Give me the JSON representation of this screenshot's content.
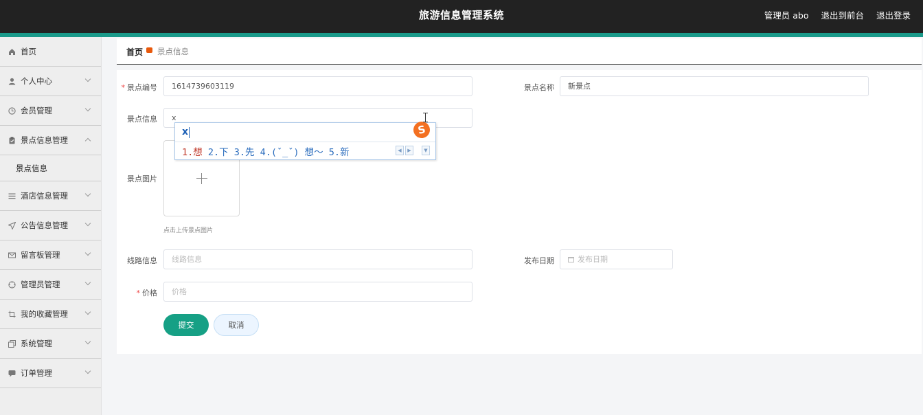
{
  "header": {
    "title": "旅游信息管理系统",
    "user": "管理员 abo",
    "to_front": "退出到前台",
    "logout": "退出登录"
  },
  "sidebar": {
    "items": [
      {
        "label": "首页",
        "icon": "home-icon"
      },
      {
        "label": "个人中心",
        "icon": "user-icon"
      },
      {
        "label": "会员管理",
        "icon": "clock-icon"
      },
      {
        "label": "景点信息管理",
        "icon": "clipboard-icon",
        "expanded": true,
        "children": [
          {
            "label": "景点信息"
          }
        ]
      },
      {
        "label": "酒店信息管理",
        "icon": "list-icon"
      },
      {
        "label": "公告信息管理",
        "icon": "send-icon"
      },
      {
        "label": "留言板管理",
        "icon": "mail-icon"
      },
      {
        "label": "管理员管理",
        "icon": "compass-icon"
      },
      {
        "label": "我的收藏管理",
        "icon": "crop-icon"
      },
      {
        "label": "系统管理",
        "icon": "copy-icon"
      },
      {
        "label": "订单管理",
        "icon": "chat-icon"
      }
    ]
  },
  "breadcrumb": {
    "home": "首页",
    "current": "景点信息"
  },
  "form": {
    "code_label": "景点编号",
    "code_value": "1614739603119",
    "name_label": "景点名称",
    "name_value": "新景点",
    "info_label": "景点信息",
    "info_value": "x",
    "image_label": "景点图片",
    "image_tip": "点击上传景点图片",
    "route_label": "线路信息",
    "route_placeholder": "线路信息",
    "date_label": "发布日期",
    "date_placeholder": "发布日期",
    "price_label": "价格",
    "price_placeholder": "价格",
    "submit": "提交",
    "cancel": "取消",
    "accent_color": "#16a085"
  },
  "ime": {
    "composition": "x",
    "candidates": "1.想  2.下  3.先  4.(ˇ_ˇ) 想～  5.新",
    "first": "1.想",
    "rest": "  2.下  3.先  4.(ˇ_ˇ) 想～  5.新",
    "logo": "S"
  }
}
